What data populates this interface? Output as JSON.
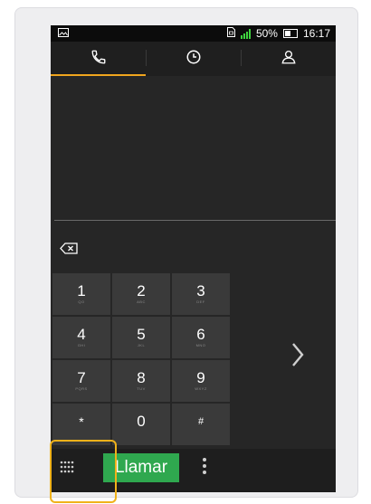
{
  "statusbar": {
    "battery": "50%",
    "time": "16:17"
  },
  "tabs": [
    {
      "icon": "phone-icon",
      "active": true
    },
    {
      "icon": "clock-icon",
      "active": false
    },
    {
      "icon": "contact-icon",
      "active": false
    }
  ],
  "keypad": {
    "keys": [
      {
        "digit": "1",
        "letters": "QO"
      },
      {
        "digit": "2",
        "letters": "ABC"
      },
      {
        "digit": "3",
        "letters": "DEF"
      },
      {
        "digit": "4",
        "letters": "GHI"
      },
      {
        "digit": "5",
        "letters": "JKL"
      },
      {
        "digit": "6",
        "letters": "MNO"
      },
      {
        "digit": "7",
        "letters": "PQRS"
      },
      {
        "digit": "8",
        "letters": "TUV"
      },
      {
        "digit": "9",
        "letters": "WXYZ"
      },
      {
        "digit": "*",
        "letters": ""
      },
      {
        "digit": "0",
        "letters": ""
      },
      {
        "digit": "#",
        "letters": ""
      }
    ]
  },
  "bottombar": {
    "call_label": "Llamar"
  },
  "colors": {
    "accent": "#f0a51e",
    "call_green": "#2fa84f",
    "signal_green": "#3fd33f",
    "highlight": "#f0b21a"
  }
}
